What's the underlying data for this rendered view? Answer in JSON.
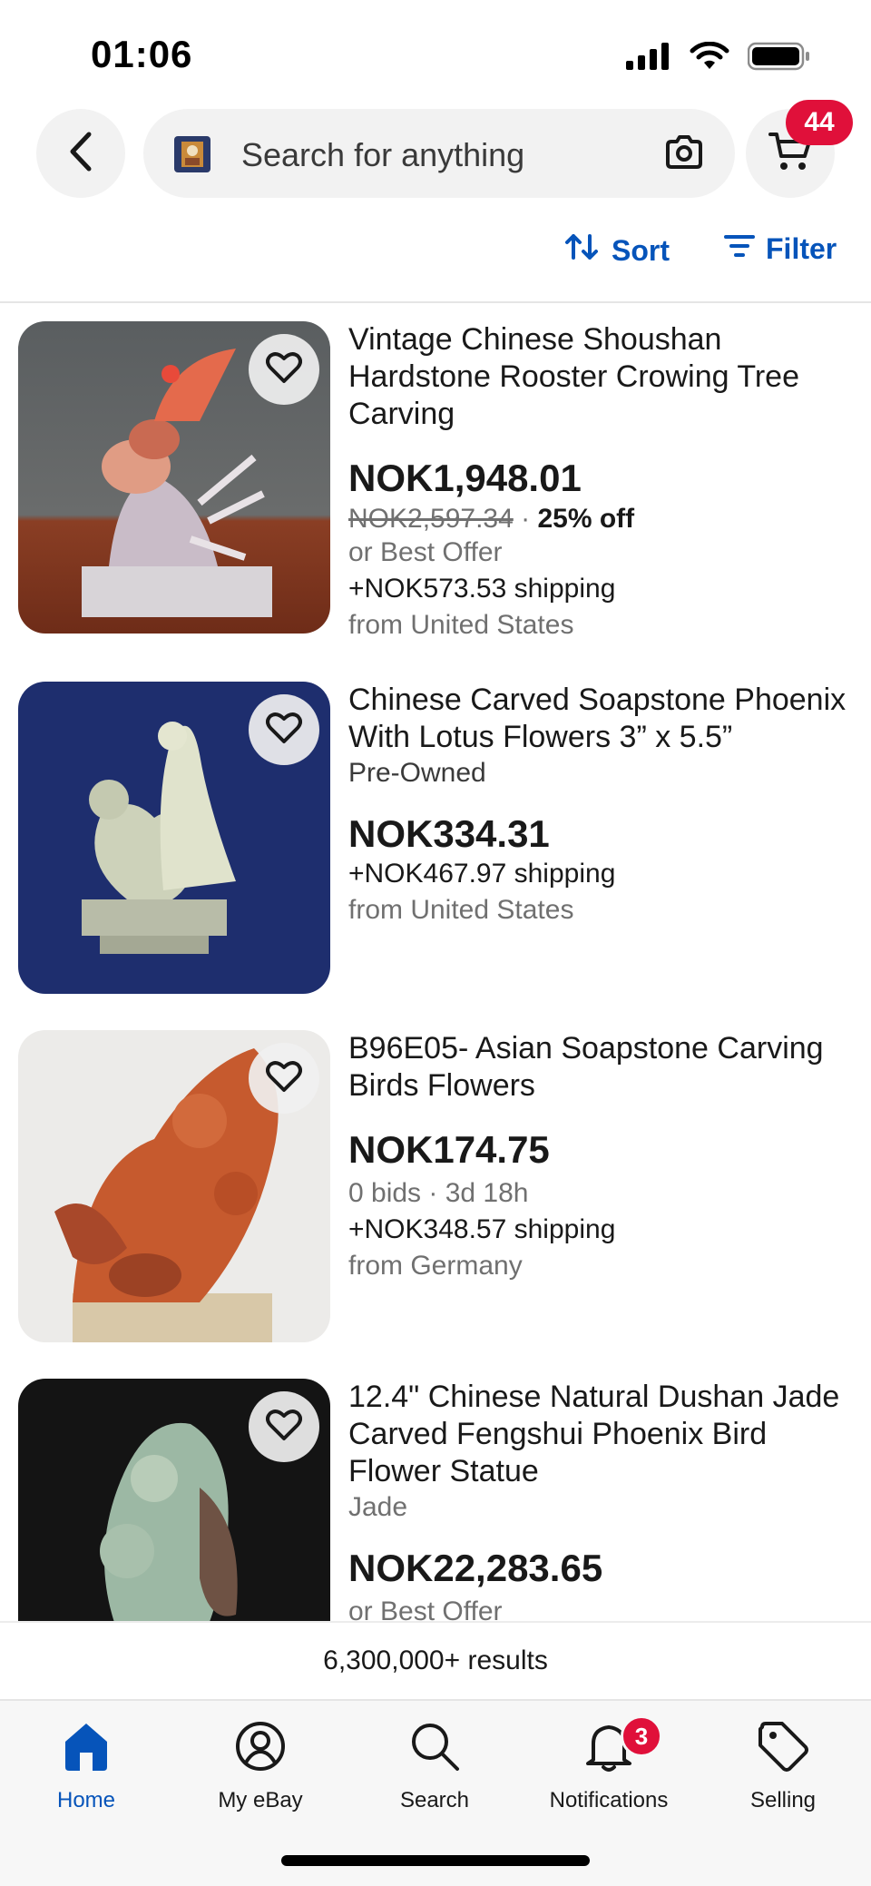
{
  "status_bar": {
    "time": "01:06"
  },
  "header": {
    "search_placeholder": "Search for anything",
    "cart_count": "44"
  },
  "toolbar": {
    "sort_label": "Sort",
    "filter_label": "Filter"
  },
  "listings": [
    {
      "title": "Vintage Chinese Shoushan Hardstone Rooster Crowing Tree Carving",
      "price": "NOK1,948.01",
      "original_price": "NOK2,597.34",
      "discount": "25% off",
      "offer": "or Best Offer",
      "shipping": "+NOK573.53 shipping",
      "location": "from United States"
    },
    {
      "title": "Chinese Carved Soapstone Phoenix With Lotus Flowers  3” x 5.5”",
      "condition": "Pre-Owned",
      "price": "NOK334.31",
      "shipping": "+NOK467.97 shipping",
      "location": "from United States"
    },
    {
      "title": "B96E05- Asian Soapstone Carving Birds Flowers",
      "price": "NOK174.75",
      "bids": "0 bids · 3d 18h",
      "shipping": "+NOK348.57 shipping",
      "location": "from Germany"
    },
    {
      "title": "12.4\" Chinese Natural Dushan Jade Carved Fengshui Phoenix Bird Flower Statue",
      "condition": "Jade",
      "price": "NOK22,283.65",
      "offer": "or Best Offer"
    }
  ],
  "results": {
    "count_text": "6,300,000+ results"
  },
  "bottom_nav": {
    "home": "Home",
    "my_ebay": "My eBay",
    "search": "Search",
    "notifications": "Notifications",
    "notifications_badge": "3",
    "selling": "Selling"
  },
  "colors": {
    "accent": "#0654ba",
    "badge": "#e0103a",
    "muted_text": "#707070"
  }
}
